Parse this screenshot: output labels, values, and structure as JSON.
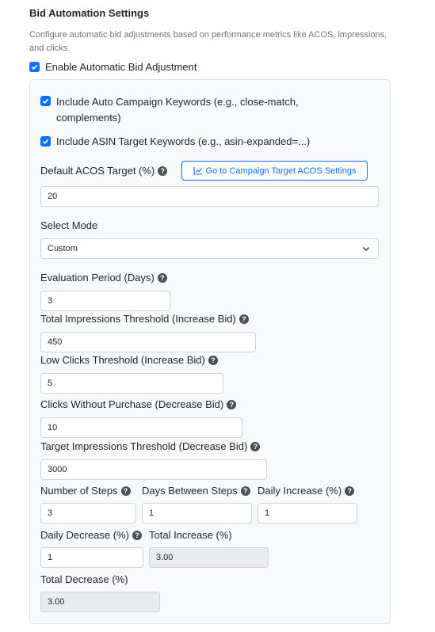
{
  "section": {
    "title": "Bid Automation Settings",
    "description": "Configure automatic bid adjustments based on performance metrics like ACOS, impressions, and clicks."
  },
  "enable_checkbox": {
    "label": "Enable Automatic Bid Adjustment",
    "checked": true
  },
  "panel": {
    "auto_campaign": {
      "label_line1": "Include Auto Campaign Keywords (e.g., close-match,",
      "label_line2": "complements)",
      "checked": true
    },
    "asin_target": {
      "label": "Include ASIN Target Keywords (e.g., asin-expanded=...)",
      "checked": true
    },
    "default_acos": {
      "label": "Default ACOS Target (%)",
      "value": "20"
    },
    "go_button": {
      "label": "Go to Campaign Target ACOS Settings"
    },
    "select_mode": {
      "label": "Select Mode",
      "value": "Custom"
    },
    "evaluation_period": {
      "label": "Evaluation Period (Days)",
      "value": "3"
    },
    "total_impressions": {
      "label": "Total Impressions Threshold (Increase Bid)",
      "value": "450"
    },
    "low_clicks": {
      "label": "Low Clicks Threshold (Increase Bid)",
      "value": "5"
    },
    "clicks_without_purchase": {
      "label": "Clicks Without Purchase (Decrease Bid)",
      "value": "10"
    },
    "target_impressions": {
      "label": "Target Impressions Threshold (Decrease Bid)",
      "value": "3000"
    },
    "number_of_steps": {
      "label": "Number of Steps",
      "value": "3"
    },
    "days_between_steps": {
      "label": "Days Between Steps",
      "value": "1"
    },
    "daily_increase": {
      "label": "Daily Increase (%)",
      "value": "1"
    },
    "daily_decrease": {
      "label": "Daily Decrease (%)",
      "value": "1"
    },
    "total_increase": {
      "label": "Total Increase (%)",
      "value": "3.00"
    },
    "total_decrease": {
      "label": "Total Decrease (%)",
      "value": "3.00"
    }
  },
  "colors": {
    "primary": "#0d6efd",
    "panel_bg": "#f8f9fa",
    "disabled_input": "#e9ecef"
  },
  "help_icon_glyph": "?"
}
